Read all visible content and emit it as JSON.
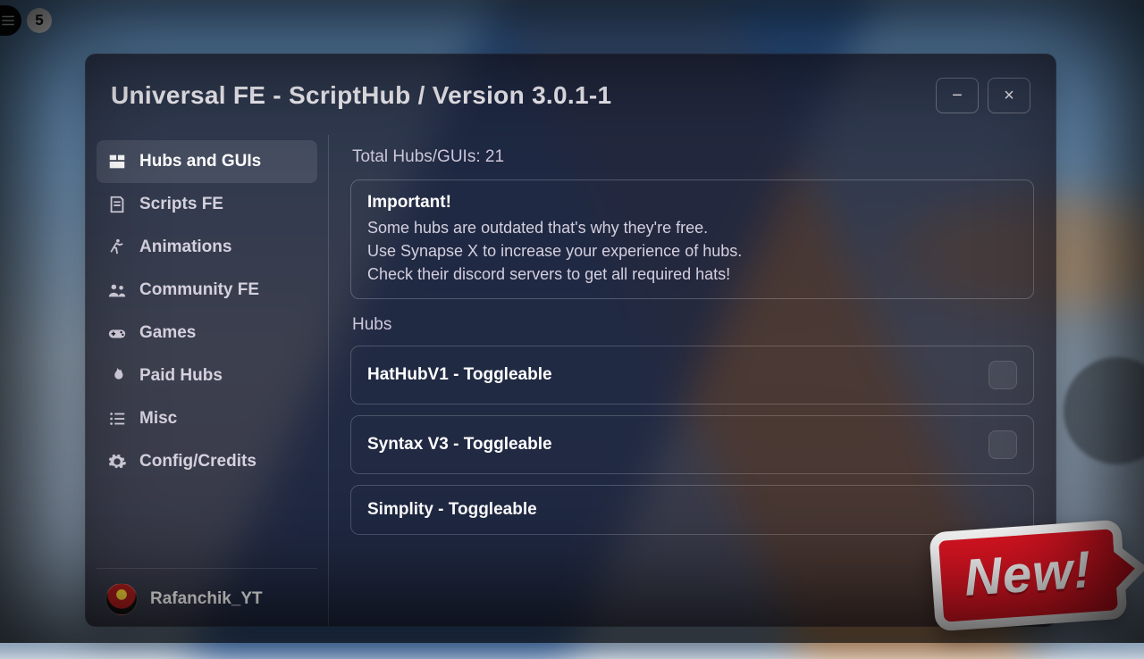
{
  "hud": {
    "count": "5"
  },
  "window": {
    "title": "Universal FE - ScriptHub / Version 3.0.1-1",
    "minimize_glyph": "−",
    "close_glyph": "×"
  },
  "sidebar": {
    "items": [
      {
        "id": "hubs",
        "label": "Hubs and GUIs",
        "icon": "grid-icon",
        "active": true
      },
      {
        "id": "scripts",
        "label": "Scripts FE",
        "icon": "note-icon",
        "active": false
      },
      {
        "id": "anim",
        "label": "Animations",
        "icon": "run-icon",
        "active": false
      },
      {
        "id": "community",
        "label": "Community FE",
        "icon": "people-icon",
        "active": false
      },
      {
        "id": "games",
        "label": "Games",
        "icon": "gamepad-icon",
        "active": false
      },
      {
        "id": "paid",
        "label": "Paid Hubs",
        "icon": "flame-icon",
        "active": false
      },
      {
        "id": "misc",
        "label": "Misc",
        "icon": "list-icon",
        "active": false
      },
      {
        "id": "config",
        "label": "Config/Credits",
        "icon": "gear-icon",
        "active": false
      }
    ],
    "user": {
      "name": "Rafanchik_YT"
    }
  },
  "content": {
    "totals_label": "Total Hubs/GUIs: 21",
    "notice": {
      "heading": "Important!",
      "lines": [
        "Some hubs are outdated that's why they're free.",
        "Use Synapse X to increase your experience of hubs.",
        "Check their discord servers to get all required hats!"
      ]
    },
    "section_label": "Hubs",
    "rows": [
      {
        "label": "HatHubV1 - Toggleable",
        "has_toggle": true
      },
      {
        "label": "Syntax V3 - Toggleable",
        "has_toggle": true
      },
      {
        "label": "Simplity - Toggleable",
        "has_toggle": false
      }
    ]
  },
  "sticker": {
    "text": "New!"
  }
}
